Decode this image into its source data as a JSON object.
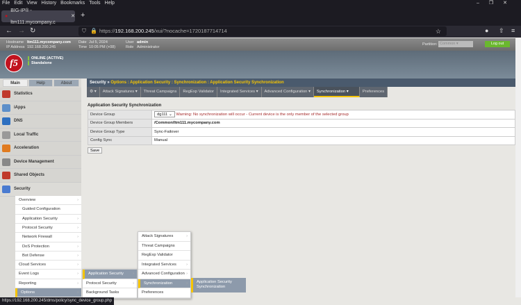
{
  "browser": {
    "menu": [
      "File",
      "Edit",
      "View",
      "History",
      "Bookmarks",
      "Tools",
      "Help"
    ],
    "tab_title": "BIG-IP® - ltm111.mycompany.c",
    "url_prefix": "https://",
    "url_host": "192.168.200.245",
    "url_path": "/xui/?nocache=1720187714714",
    "status_url": "https://192.168.200.245/dms/policy/sync_device_group.php"
  },
  "header": {
    "hostname_label": "Hostname",
    "hostname": "ltm111.mycompany.com",
    "ip_label": "IP Address",
    "ip": "192.168.200.245",
    "date_label": "Date",
    "date": "Jul 5, 2024",
    "time_label": "Time",
    "time": "10:05 PM (+08)",
    "user_label": "User",
    "user": "admin",
    "role_label": "Role",
    "role": "Administrator",
    "partition_label": "Partition:",
    "partition": "Common",
    "logout": "Log out",
    "status": "ONLINE (ACTIVE)",
    "mode": "Standalone",
    "logo": "f5"
  },
  "sidebar": {
    "tabs": [
      "Main",
      "Help",
      "About"
    ],
    "items": [
      {
        "label": "Statistics",
        "color": "#c0392b"
      },
      {
        "label": "iApps",
        "color": "#5d8fc9"
      },
      {
        "label": "DNS",
        "color": "#2d6fc0"
      },
      {
        "label": "Local Traffic",
        "color": "#999999"
      },
      {
        "label": "Acceleration",
        "color": "#e07b20"
      },
      {
        "label": "Device Management",
        "color": "#888888"
      },
      {
        "label": "Shared Objects",
        "color": "#c0392b"
      },
      {
        "label": "Security",
        "color": "#4a7bd0"
      }
    ],
    "security_sub": [
      "Overview",
      "Guided Configuration",
      "Application Security",
      "Protocol Security",
      "Network Firewall",
      "DoS Protection",
      "Bot Defense",
      "Cloud Services",
      "Event Logs",
      "Reporting",
      "Options"
    ]
  },
  "breadcrumb": {
    "root": "Security",
    "sep": "»",
    "path": "Options : Application Security : Synchronization : Application Security Synchronization"
  },
  "subtabs": [
    "⚙ ▾",
    "Attack Signatures ▾",
    "Threat Campaigns",
    "RegExp Validator",
    "Integrated Services ▾",
    "Advanced Configuration ▾",
    "Synchronization ▾",
    "Preferences"
  ],
  "main": {
    "heading": "Application Security Synchronization",
    "rows": [
      {
        "label": "Device Group",
        "value": "dg111"
      },
      {
        "label": "Device Group Members",
        "value": "/Common/ltm111.mycompany.com"
      },
      {
        "label": "Device Group Type",
        "value": "Sync-Failover"
      },
      {
        "label": "Config Sync",
        "value": "Manual"
      }
    ],
    "warning": "Warning: No synchronization will occur - Current device is the only member of the selected group",
    "save": "Save"
  },
  "flyout1": [
    "Application Security",
    "Protocol Security",
    "Background Tasks"
  ],
  "flyout2": [
    "Attack Signatures",
    "Threat Campaigns",
    "RegExp Validator",
    "Integrated Services",
    "Advanced Configuration",
    "Synchronization",
    "Preferences"
  ],
  "flyout3": "Application Security Synchronization"
}
